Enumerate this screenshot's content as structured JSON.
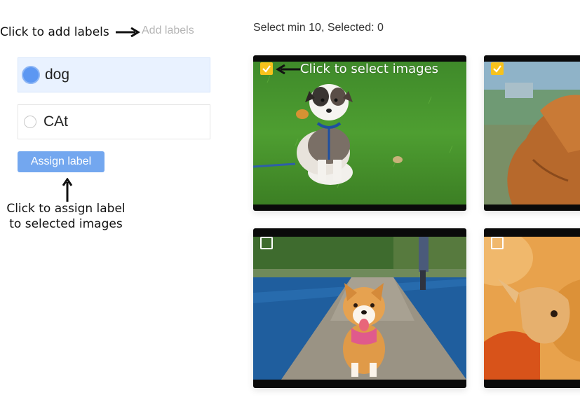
{
  "annotations": {
    "add_labels_hint": "Click to add labels",
    "select_images_hint": "Click to select images",
    "assign_hint_line1": "Click to assign label",
    "assign_hint_line2": "to selected images"
  },
  "labels_panel": {
    "add_labels_link": "Add labels",
    "labels": [
      {
        "name": "dog",
        "selected": true
      },
      {
        "name": "CAt",
        "selected": false
      }
    ],
    "assign_button": "Assign label"
  },
  "gallery": {
    "status": "Select min 10, Selected: 0",
    "images": [
      {
        "subject": "puppy on grass",
        "checked": true
      },
      {
        "subject": "golden retriever",
        "checked": true
      },
      {
        "subject": "corgi on pier",
        "checked": false
      },
      {
        "subject": "chihuahua",
        "checked": false
      }
    ]
  },
  "colors": {
    "accent": "#73a7ef",
    "selected_row_bg": "#e9f2ff",
    "checkbox_checked": "#f7c21c",
    "card_frame": "#0a0a0a"
  }
}
